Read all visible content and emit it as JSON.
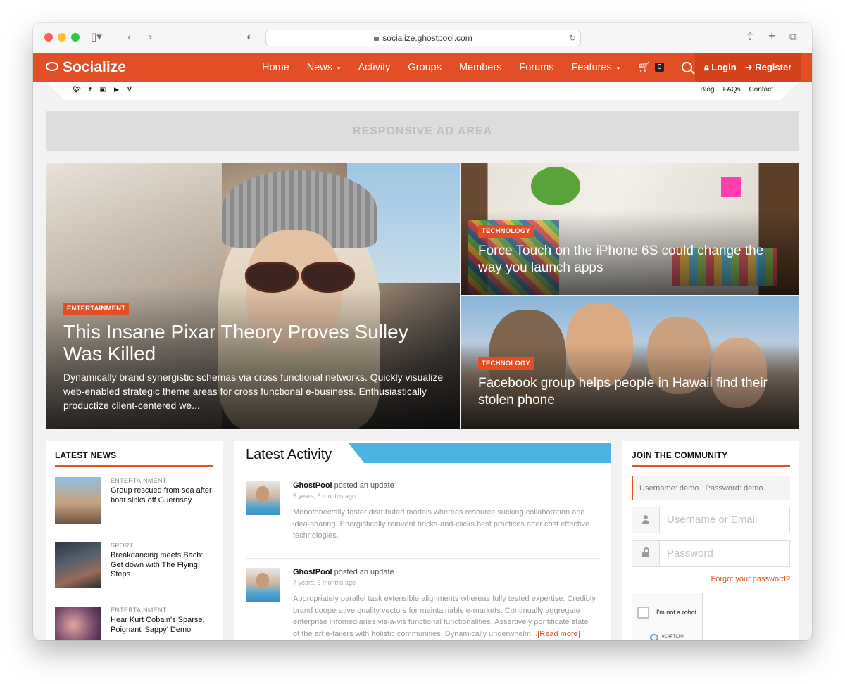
{
  "browser": {
    "url": "socialize.ghostpool.com"
  },
  "site": {
    "logo": "Socialize",
    "nav": {
      "home": "Home",
      "news": "News",
      "activity": "Activity",
      "groups": "Groups",
      "members": "Members",
      "forums": "Forums",
      "features": "Features"
    },
    "cart_count": "0",
    "login": "Login",
    "register": "Register",
    "top_links": {
      "blog": "Blog",
      "faqs": "FAQs",
      "contact": "Contact"
    },
    "social_icons": [
      "twitter-icon",
      "facebook-icon",
      "vimeo-icon",
      "youtube-icon",
      "vine-icon"
    ],
    "accent_color": "#e24e25"
  },
  "ad": {
    "text": "RESPONSIVE AD AREA"
  },
  "hero": {
    "main": {
      "category": "ENTERTAINMENT",
      "title": "This Insane Pixar Theory Proves Sulley Was Killed",
      "excerpt": "Dynamically brand synergistic schemas via cross functional networks. Quickly visualize web-enabled strategic theme areas for cross functional e-business. Enthusiastically productize client-centered we..."
    },
    "side": [
      {
        "category": "TECHNOLOGY",
        "title": "Force Touch on the iPhone 6S could change the way you launch apps"
      },
      {
        "category": "TECHNOLOGY",
        "title": "Facebook group helps people in Hawaii find their stolen phone"
      }
    ]
  },
  "latest_news": {
    "title": "LATEST NEWS",
    "items": [
      {
        "category": "ENTERTAINMENT",
        "title": "Group rescued from sea after boat sinks off Guernsey"
      },
      {
        "category": "SPORT",
        "title": "Breakdancing meets Bach: Get down with The Flying Steps"
      },
      {
        "category": "ENTERTAINMENT",
        "title": "Hear Kurt Cobain's Sparse, Poignant 'Sappy' Demo"
      }
    ]
  },
  "activity": {
    "title": "Latest Activity",
    "entries": [
      {
        "user": "GhostPool",
        "action": "posted an update",
        "time": "5 years, 5 months ago",
        "text": "Monotonectally foster distributed models whereas resource sucking collaboration and idea-sharing. Energistically reinvent bricks-and-clicks best practices after cost effective technologies."
      },
      {
        "user": "GhostPool",
        "action": "posted an update",
        "time": "7 years, 5 months ago",
        "text": "Appropriately parallel task extensible alignments whereas fully tested expertise. Credibly brand cooperative quality vectors for maintainable e-markets. Continually aggregate enterprise infomediaries vis-a-vis functional functionalities. Assertively pontificate state of the art e-tailers with holistic communities. Dynamically underwhelm...",
        "read_more": "[Read more]"
      }
    ]
  },
  "join": {
    "title": "JOIN THE COMMUNITY",
    "demo_credentials": "Username: demo   Password: demo",
    "username_placeholder": "Username or Email",
    "password_placeholder": "Password",
    "forgot": "Forgot your password?",
    "captcha_label": "I'm not a robot",
    "captcha_brand": "reCAPTCHA"
  }
}
